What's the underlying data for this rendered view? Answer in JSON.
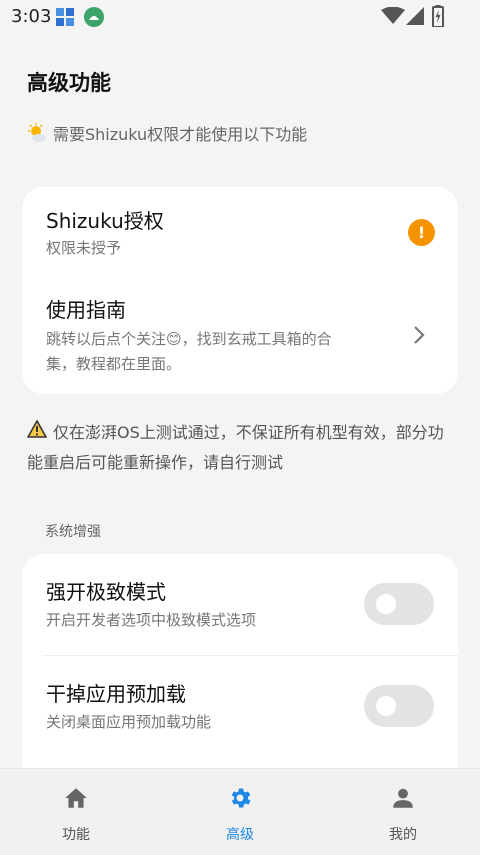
{
  "status_bar": {
    "time": "3:03"
  },
  "page": {
    "title": "高级功能",
    "shizuku_note": "需要Shizuku权限才能使用以下功能"
  },
  "shizuku_card": {
    "auth": {
      "title": "Shizuku授权",
      "subtitle": "权限未授予",
      "badge": "!"
    },
    "guide": {
      "title": "使用指南",
      "subtitle_line1": "跳转以后点个关注😊，找到玄戒工具箱的合",
      "subtitle_line2": "集，教程都在里面。"
    }
  },
  "warning_note": "仅在澎湃OS上测试通过，不保证所有机型有效，部分功能重启后可能重新操作，请自行测试",
  "system_section": {
    "label": "系统增强",
    "items": [
      {
        "title": "强开极致模式",
        "subtitle": "开启开发者选项中极致模式选项",
        "enabled": false
      },
      {
        "title": "干掉应用预加载",
        "subtitle": "关闭桌面应用预加载功能",
        "enabled": false
      }
    ]
  },
  "bottom_nav": {
    "items": [
      {
        "label": "功能",
        "icon": "home-icon"
      },
      {
        "label": "高级",
        "icon": "gear-icon",
        "active": true
      },
      {
        "label": "我的",
        "icon": "person-icon"
      }
    ]
  },
  "colors": {
    "accent": "#1e88e5",
    "warning": "#f59300",
    "toggle_off": "#e3e3e6"
  }
}
